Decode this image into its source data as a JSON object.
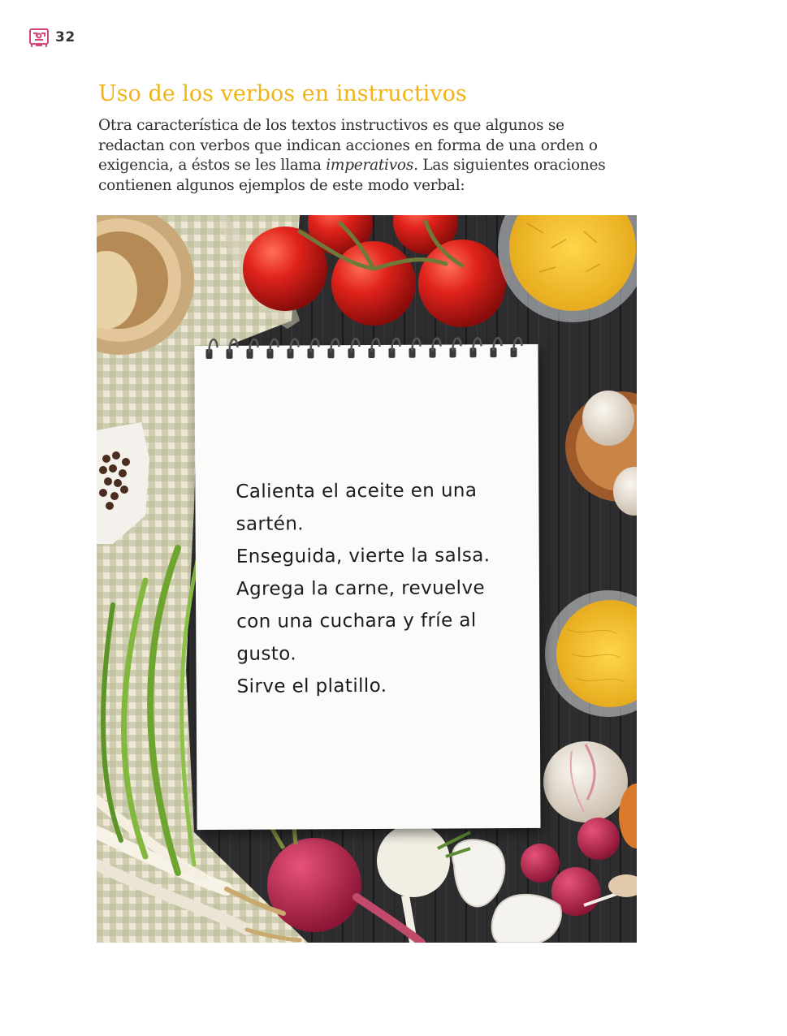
{
  "header": {
    "page_number": "32",
    "logo_icon": "aztec-glyph-icon"
  },
  "section": {
    "title": "Uso de los verbos en instructivos",
    "intro_before": "Otra característica de los textos instructivos es que algunos se redactan con verbos que indican acciones en forma de una orden o exigencia, a éstos se les llama ",
    "intro_emphasis": "imperativos",
    "intro_after": ". Las siguientes oraciones contienen algunos ejemplos de este modo verbal:"
  },
  "notebook": {
    "lines": [
      "Calienta el aceite en una",
      "sartén.",
      "Enseguida, vierte la salsa.",
      "Agrega la carne, revuelve",
      "con una cuchara y fríe al",
      "gusto.",
      "Sirve el platillo."
    ]
  },
  "colors": {
    "title": "#f2b316",
    "logo": "#d5457a",
    "body_text": "#2f2f2f"
  }
}
